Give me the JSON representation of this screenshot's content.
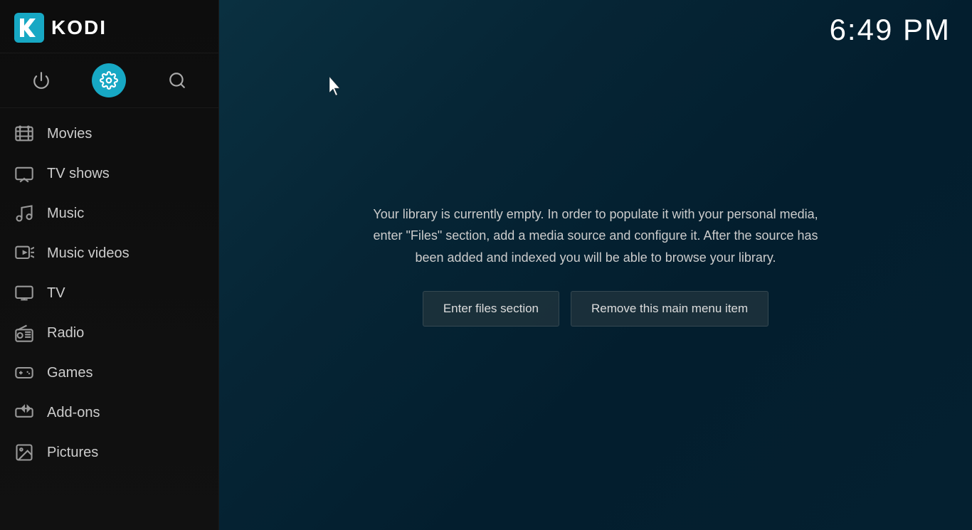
{
  "app": {
    "name": "KODI"
  },
  "time": "6:49 PM",
  "sidebar": {
    "icons": {
      "power_label": "Power",
      "settings_label": "Settings",
      "search_label": "Search"
    },
    "nav_items": [
      {
        "id": "movies",
        "label": "Movies",
        "icon": "film"
      },
      {
        "id": "tv-shows",
        "label": "TV shows",
        "icon": "tv"
      },
      {
        "id": "music",
        "label": "Music",
        "icon": "music"
      },
      {
        "id": "music-videos",
        "label": "Music videos",
        "icon": "music-video"
      },
      {
        "id": "tv",
        "label": "TV",
        "icon": "tv2"
      },
      {
        "id": "radio",
        "label": "Radio",
        "icon": "radio"
      },
      {
        "id": "games",
        "label": "Games",
        "icon": "gamepad"
      },
      {
        "id": "add-ons",
        "label": "Add-ons",
        "icon": "addon"
      },
      {
        "id": "pictures",
        "label": "Pictures",
        "icon": "pictures"
      }
    ]
  },
  "main": {
    "library_message": "Your library is currently empty. In order to populate it with your personal media, enter \"Files\" section, add a media source and configure it. After the source has been added and indexed you will be able to browse your library.",
    "button_enter_files": "Enter files section",
    "button_remove_menu": "Remove this main menu item"
  }
}
